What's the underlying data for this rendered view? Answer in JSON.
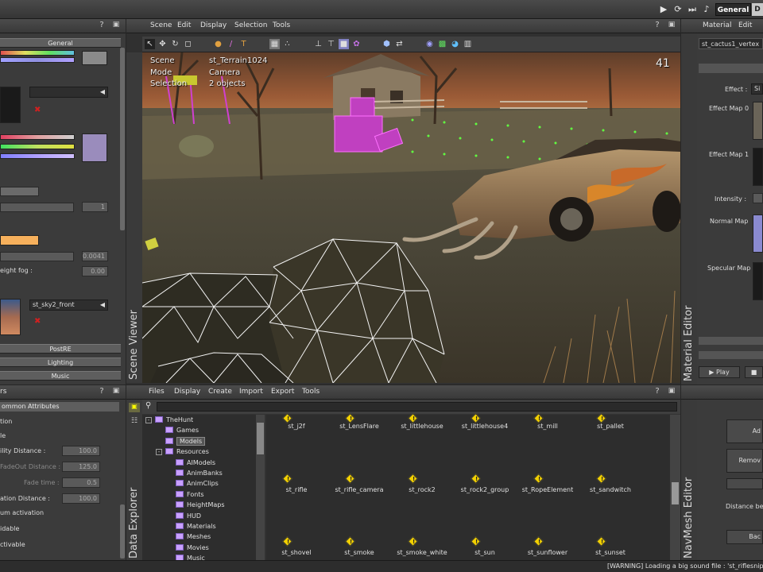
{
  "topbar": {
    "tab_general": "General",
    "tab_other": "D",
    "play": "▶",
    "refresh": "⟳",
    "step": "⏭",
    "music": "♪"
  },
  "left_panel": {
    "title_q": "?",
    "sections": {
      "general": "General",
      "postre": "PostRE",
      "lighting": "Lighting",
      "music": "Music"
    },
    "fields": {
      "fog_density": "1",
      "fog_density2": "0.0041",
      "height_fog_value": "0.00"
    },
    "labels": {
      "height_fog": "eight fog :"
    },
    "sky_texture": "st_sky2_front"
  },
  "scene_viewer": {
    "menu": [
      "Scene",
      "Edit",
      "Display",
      "Selection",
      "Tools"
    ],
    "vertical_title": "Scene Viewer",
    "hud": {
      "scene_label": "Scene",
      "scene_value": "st_Terrain1024",
      "mode_label": "Mode",
      "mode_value": "Camera",
      "selection_label": "Selection",
      "selection_value": "2 objects",
      "fps": "41"
    }
  },
  "material_editor": {
    "menu": [
      "Material",
      "Edit"
    ],
    "vertical_title": "Material Editor",
    "material_name": "st_cactus1_vertex",
    "labels": {
      "effect": "Effect :",
      "effect_value": "Si",
      "effect_map0": "Effect Map 0",
      "effect_map1": "Effect Map 1",
      "intensity": "Intensity :",
      "normal_map": "Normal Map",
      "specular_map": "Specular Map"
    },
    "play": "Play"
  },
  "left_bottom": {
    "title": "rs",
    "common": "ommon Attributes",
    "rows": [
      "tion",
      "le",
      "ility Distance :",
      "FadeOut Distance :",
      "Fade time :",
      "ation Distance :",
      "um activation",
      "idable",
      "ctivable"
    ],
    "values": [
      "100.0",
      "125.0",
      "0.5",
      "100.0"
    ]
  },
  "data_explorer": {
    "menu": [
      "Files",
      "Display",
      "Create",
      "Import",
      "Export",
      "Tools"
    ],
    "vertical_title": "Data Explorer",
    "tree": [
      {
        "label": "TheHunt",
        "level": 0,
        "exp": "-"
      },
      {
        "label": "Games",
        "level": 1,
        "exp": ""
      },
      {
        "label": "Models",
        "level": 1,
        "exp": "",
        "selected": true
      },
      {
        "label": "Resources",
        "level": 1,
        "exp": "-"
      },
      {
        "label": "AIModels",
        "level": 2,
        "exp": ""
      },
      {
        "label": "AnimBanks",
        "level": 2,
        "exp": ""
      },
      {
        "label": "AnimClips",
        "level": 2,
        "exp": ""
      },
      {
        "label": "Fonts",
        "level": 2,
        "exp": ""
      },
      {
        "label": "HeightMaps",
        "level": 2,
        "exp": ""
      },
      {
        "label": "HUD",
        "level": 2,
        "exp": ""
      },
      {
        "label": "Materials",
        "level": 2,
        "exp": ""
      },
      {
        "label": "Meshes",
        "level": 2,
        "exp": ""
      },
      {
        "label": "Movies",
        "level": 2,
        "exp": ""
      },
      {
        "label": "Music",
        "level": 2,
        "exp": ""
      }
    ],
    "assets_row1": [
      "st_j2f",
      "st_LensFlare",
      "st_littlehouse",
      "st_littlehouse4",
      "st_mill",
      "st_pallet"
    ],
    "assets_row2": [
      "st_rifle",
      "st_rifle_camera",
      "st_rock2",
      "st_rock2_group",
      "st_RopeElement",
      "st_sandwitch"
    ],
    "assets_row3": [
      "st_shovel",
      "st_smoke",
      "st_smoke_white",
      "st_sun",
      "st_sunflower",
      "st_sunset"
    ]
  },
  "navmesh_editor": {
    "vertical_title": "NavMesh Editor",
    "buttons": [
      "Ad",
      "Remov",
      "",
      "Bac"
    ],
    "distance_label": "Distance bef"
  },
  "status": {
    "message": "[WARNING] Loading a big sound file : 'st_riflesnipe"
  }
}
